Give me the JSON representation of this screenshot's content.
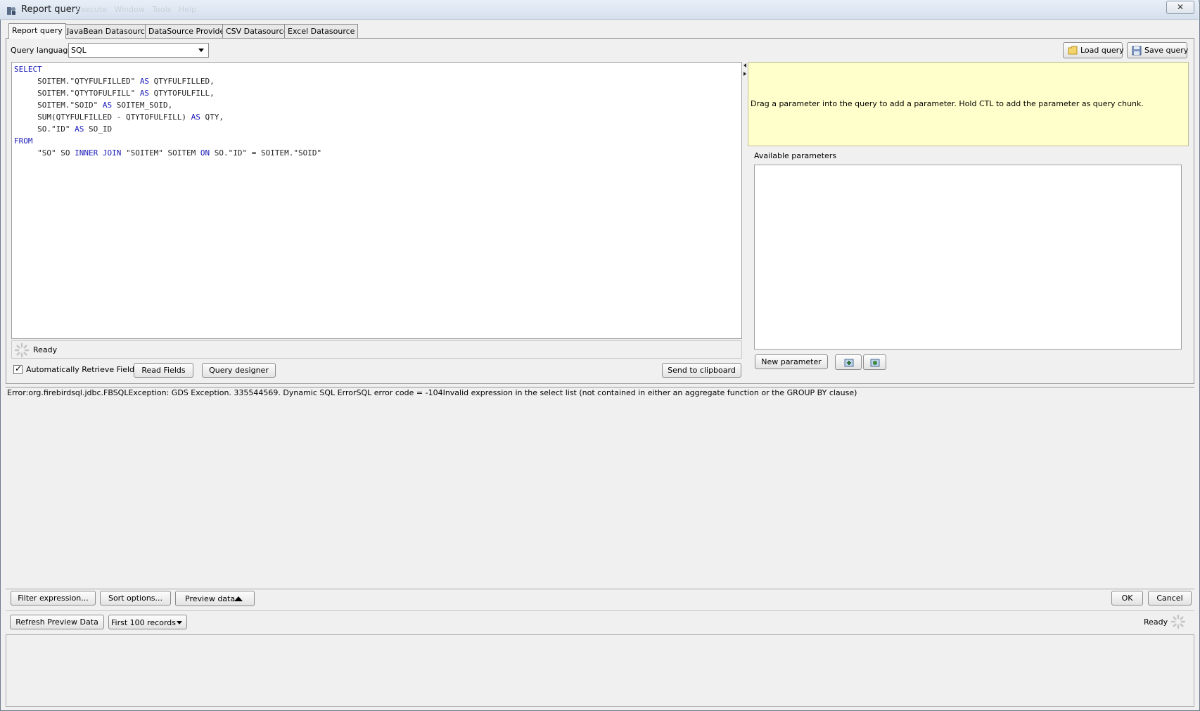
{
  "window": {
    "title": "Report query",
    "menu_ghost": "Execute   Window   Tools   Help",
    "close_icon": "close-icon"
  },
  "tabs": [
    {
      "label": "Report query",
      "active": true
    },
    {
      "label": "JavaBean Datasource"
    },
    {
      "label": "DataSource Provider"
    },
    {
      "label": "CSV Datasource"
    },
    {
      "label": "Excel Datasource"
    }
  ],
  "query_language": {
    "label": "Query language",
    "value": "SQL"
  },
  "toolbar": {
    "load_query": "Load query",
    "save_query": "Save query"
  },
  "editor": {
    "lines": [
      {
        "kw": "SELECT",
        "text": ""
      },
      {
        "kw": "",
        "pre": "     SOITEM.\"QTYFULFILLED\" ",
        "kw2": "AS",
        "post": " QTYFULFILLED,"
      },
      {
        "kw": "",
        "pre": "     SOITEM.\"QTYTOFULFILL\" ",
        "kw2": "AS",
        "post": " QTYTOFULFILL,"
      },
      {
        "kw": "",
        "pre": "     SOITEM.\"SOID\" ",
        "kw2": "AS",
        "post": " SOITEM_SOID,"
      },
      {
        "kw": "",
        "pre": "     SUM(QTYFULFILLED - QTYTOFULFILL) ",
        "kw2": "AS",
        "post": " QTY,"
      },
      {
        "kw": "",
        "pre": "     SO.\"ID\" ",
        "kw2": "AS",
        "post": " SO_ID"
      },
      {
        "kw": "FROM",
        "text": ""
      },
      {
        "kw": "",
        "pre": "     \"SO\" SO ",
        "kw2": "INNER JOIN",
        "post": " \"SOITEM\" SOITEM ",
        "kw3": "ON",
        "post2": " SO.\"ID\" = SOITEM.\"SOID\""
      }
    ],
    "status": "Ready"
  },
  "controls": {
    "auto_retrieve": "Automatically Retrieve Fields",
    "auto_retrieve_checked": true,
    "read_fields": "Read Fields",
    "query_designer": "Query designer",
    "send_to_clipboard": "Send to clipboard"
  },
  "parameters": {
    "hint": "Drag a parameter into the query to add a parameter. Hold CTL to add the parameter as query chunk.",
    "available_label": "Available parameters",
    "new_parameter": "New parameter"
  },
  "error": {
    "message": "Error:org.firebirdsql.jdbc.FBSQLException: GDS Exception. 335544569. Dynamic SQL ErrorSQL error code = -104Invalid expression in the select list (not contained in either an aggregate function or the GROUP BY clause)"
  },
  "bottom_bar": {
    "filter_expression": "Filter expression...",
    "sort_options": "Sort options...",
    "preview_data": "Preview data",
    "ok": "OK",
    "cancel": "Cancel"
  },
  "preview": {
    "refresh": "Refresh Preview Data",
    "records": "First 100 records",
    "status": "Ready"
  },
  "colors": {
    "keyword": "#1a1ab8",
    "hint_bg": "#ffffcc"
  }
}
